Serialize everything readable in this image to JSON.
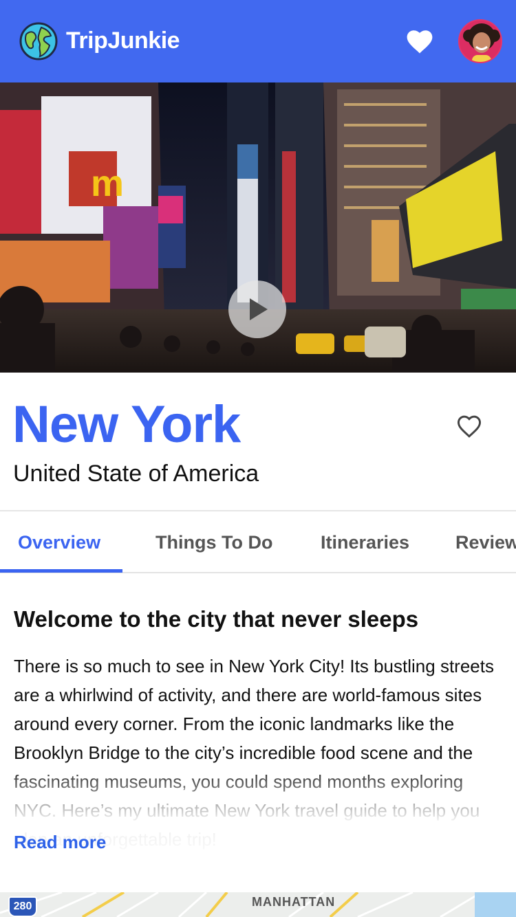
{
  "app": {
    "name": "TripJunkie"
  },
  "colors": {
    "brand": "#4169f0",
    "accent": "#3b64f1",
    "link": "#2f62e8"
  },
  "header": {
    "logo_icon": "globe-icon",
    "favorites_icon": "heart-filled-icon",
    "avatar_icon": "user-avatar"
  },
  "hero": {
    "play_icon": "play-icon"
  },
  "destination": {
    "city": "New York",
    "country": "United State of America",
    "favorite_icon": "heart-outline-icon"
  },
  "tabs": [
    {
      "label": "Overview",
      "active": true
    },
    {
      "label": "Things To Do",
      "active": false
    },
    {
      "label": "Itineraries",
      "active": false
    },
    {
      "label": "Reviews",
      "active": false
    }
  ],
  "overview": {
    "heading": "Welcome to the city that never sleeps",
    "body": "There is so much to see in New York City! Its bustling streets are a whirlwind of activity, and there are world-famous sites around every corner. From the iconic landmarks like the Brooklyn Bridge to the city’s incredible food scene and the fascinating museums, you could spend months exploring NYC. Here’s my ultimate New York travel guide to help you plan an unforgettable trip!",
    "read_more": "Read more"
  },
  "map": {
    "label": "MANHATTAN",
    "route_shield": "280"
  }
}
